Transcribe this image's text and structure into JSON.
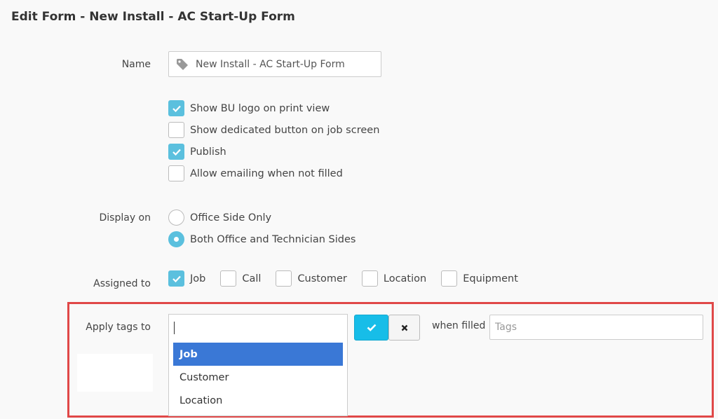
{
  "page_title": "Edit Form - New Install - AC Start-Up Form",
  "name_field": {
    "label": "Name",
    "value": "New Install - AC Start-Up Form",
    "icon": "tag-icon"
  },
  "options": [
    {
      "label": "Show BU logo on print view",
      "checked": true
    },
    {
      "label": "Show dedicated button on job screen",
      "checked": false
    },
    {
      "label": "Publish",
      "checked": true
    },
    {
      "label": "Allow emailing when not filled",
      "checked": false
    }
  ],
  "display_on": {
    "label": "Display on",
    "choices": [
      {
        "label": "Office Side Only",
        "selected": false
      },
      {
        "label": "Both Office and Technician Sides",
        "selected": true
      }
    ]
  },
  "assigned_to": {
    "label": "Assigned to",
    "items": [
      {
        "label": "Job",
        "checked": true
      },
      {
        "label": "Call",
        "checked": false
      },
      {
        "label": "Customer",
        "checked": false
      },
      {
        "label": "Location",
        "checked": false
      },
      {
        "label": "Equipment",
        "checked": false
      }
    ]
  },
  "apply_tags": {
    "label": "Apply tags to",
    "search_value": "",
    "dropdown_options": [
      "Job",
      "Customer",
      "Location"
    ],
    "active_option": "Job",
    "when_filled_label": "when filled",
    "tags_placeholder": "Tags"
  },
  "colors": {
    "checkbox_on": "#5bc0de",
    "confirm_button": "#17bde8",
    "dropdown_active": "#3a78d6",
    "highlight_border": "#e04848"
  }
}
